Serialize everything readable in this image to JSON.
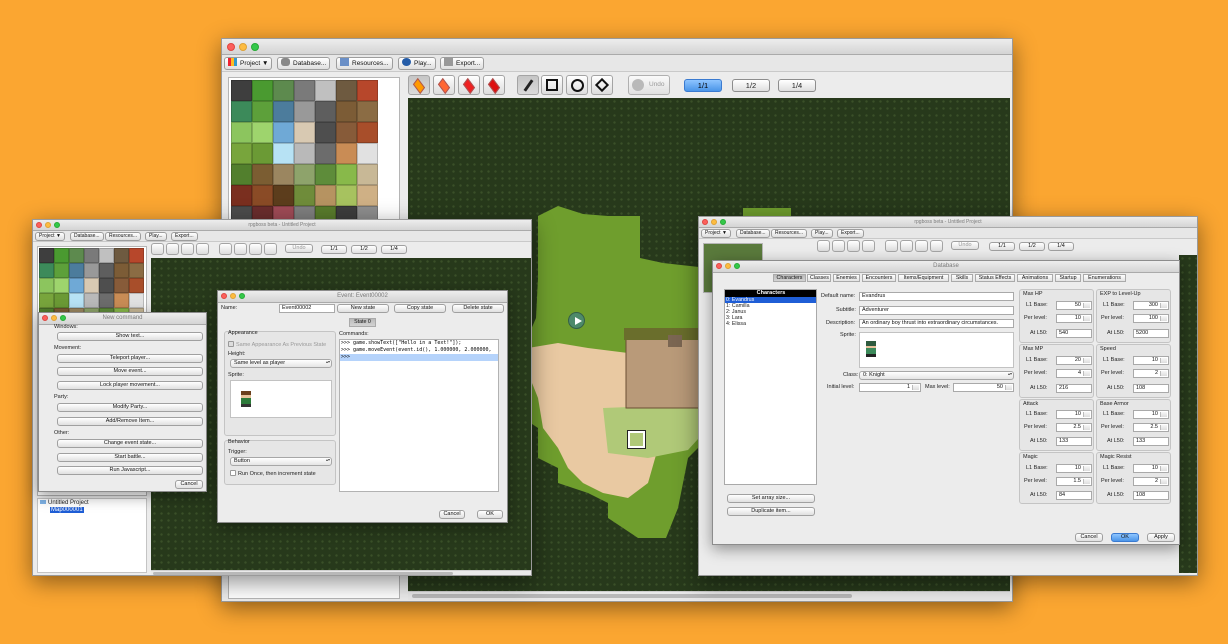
{
  "main_window": {
    "toolbar": {
      "project": "Project ▼",
      "database": "Database...",
      "resources": "Resources...",
      "play": "Play...",
      "export": "Export..."
    },
    "undo": "Undo",
    "zoom": [
      "1/1",
      "1/2",
      "1/4"
    ],
    "zoom_selected": "1/1"
  },
  "left_window": {
    "title": "rpgboss beta - Untitled Project",
    "toolbar": {
      "project": "Project ▼",
      "database": "Database...",
      "resources": "Resources...",
      "play": "Play...",
      "export": "Export..."
    },
    "undo": "Undo",
    "zoom": [
      "1/1",
      "1/2",
      "1/4"
    ],
    "tree": {
      "root": "Untitled Project",
      "child": "Map000001"
    }
  },
  "right_window": {
    "title": "rpgboss beta - Untitled Project",
    "toolbar": {
      "project": "Project ▼",
      "database": "Database...",
      "resources": "Resources...",
      "play": "Play...",
      "export": "Export..."
    },
    "undo": "Undo",
    "zoom": [
      "1/1",
      "1/2",
      "1/4"
    ]
  },
  "new_command": {
    "title": "New command",
    "sections": {
      "windows": "Windows:",
      "movement": "Movement:",
      "party": "Party:",
      "other": "Other:"
    },
    "buttons": {
      "show_text": "Show text...",
      "teleport": "Teleport player...",
      "move_event": "Move event...",
      "lock": "Lock player movement...",
      "modify_party": "Modify Party...",
      "add_remove": "Add/Remove Item...",
      "change_state": "Change event state...",
      "start_battle": "Start battle...",
      "run_js": "Run Javascript..."
    },
    "cancel": "Cancel"
  },
  "event": {
    "title": "Event: Event00002",
    "name_label": "Name:",
    "name_value": "Event00002",
    "new_state": "New state",
    "copy_state": "Copy state",
    "delete_state": "Delete state",
    "state_tab": "State 0",
    "appearance": "Appearance",
    "same_appearance": "Same Appearance As Previous State",
    "height_label": "Height:",
    "height_value": "Same level as player",
    "sprite_label": "Sprite:",
    "behavior": "Behavior",
    "trigger_label": "Trigger:",
    "trigger_value": "Button",
    "run_once": "Run Once, then increment state",
    "commands_label": "Commands:",
    "commands": [
      ">>> game.showText([\"Hello in a Text!\"]);",
      ">>> game.moveEvent(event.id(), 1.000000, 2.000000,",
      ">>>"
    ],
    "cancel": "Cancel",
    "ok": "OK"
  },
  "database": {
    "title": "Database",
    "tabs": [
      "Characters",
      "Classes",
      "Enemies",
      "Encounters",
      "Items/Equipment",
      "Skills",
      "Status Effects",
      "Animations",
      "Startup",
      "Enumerations"
    ],
    "list_header": "Characters",
    "characters": [
      "0: Evandrus",
      "1: Camilla",
      "2: Janus",
      "3: Lara",
      "4: Elissa"
    ],
    "set_array": "Set array size...",
    "duplicate": "Duplicate item...",
    "default_name_label": "Default name:",
    "default_name": "Evandrus",
    "subtitle_label": "Subtitle:",
    "subtitle": "Adventurer",
    "description_label": "Description:",
    "description": "An ordinary boy thrust into extraordinary circumstances.",
    "sprite_label": "Sprite:",
    "class_label": "Class:",
    "class_value": "0: Knight",
    "initial_level_label": "Initial level:",
    "initial_level": "1",
    "max_level_label": "Max level:",
    "max_level": "50",
    "stats": [
      {
        "title": "Max HP",
        "l1": "50",
        "per": "10",
        "at": "540"
      },
      {
        "title": "EXP to Level-Up",
        "l1": "300",
        "per": "100",
        "at": "5200"
      },
      {
        "title": "Max MP",
        "l1": "20",
        "per": "4",
        "at": "216"
      },
      {
        "title": "Speed",
        "l1": "10",
        "per": "2",
        "at": "108"
      },
      {
        "title": "Attack",
        "l1": "10",
        "per": "2.5",
        "at": "133"
      },
      {
        "title": "Base Armor",
        "l1": "10",
        "per": "2.5",
        "at": "133"
      },
      {
        "title": "Magic",
        "l1": "10",
        "per": "1.5",
        "at": "84"
      },
      {
        "title": "Magic Resist",
        "l1": "10",
        "per": "2",
        "at": "108"
      }
    ],
    "stat_labels": {
      "l1": "L1 Base:",
      "per": "Per level:",
      "at": "At L50:"
    },
    "cancel": "Cancel",
    "ok": "OK",
    "apply": "Apply"
  },
  "colors": {
    "background": "#fba631",
    "grass_dark": "#27391b",
    "grass": "#6f9e2d",
    "sand": "#e9c9a2",
    "accent": "#4b95e8"
  }
}
